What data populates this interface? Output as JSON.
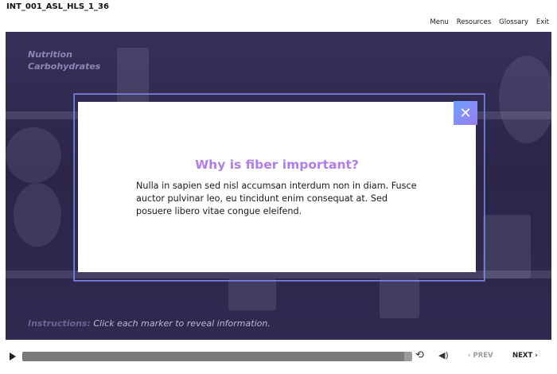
{
  "header": {
    "course_id": "INT_001_ASL_HLS_1_36",
    "nav": [
      "Menu",
      "Resources",
      "Glossary",
      "Exit"
    ]
  },
  "stage": {
    "title": "Nutrition",
    "subtitle": "Carbohydrates",
    "instructions_label": "Instructions:",
    "instructions_text": "Click each marker to reveal information."
  },
  "modal": {
    "title": "Why is fiber important?",
    "body": "Nulla in sapien sed nisl accumsan interdum non in diam. Fusce auctor pulvinar leo, eu tincidunt enim consequat at. Sed posuere libero vitae congue eleifend.",
    "close_icon": "close-icon"
  },
  "controls": {
    "prev_label": "‹ PREV",
    "next_label": "NEXT ›",
    "progress": 0.98,
    "play_icon": "play-icon",
    "replay_icon": "replay-icon",
    "volume_icon": "volume-icon"
  },
  "colors": {
    "accent": "#b07cf0",
    "frame": "#6c8fe6",
    "stage_bg": "#2f2a4f"
  }
}
